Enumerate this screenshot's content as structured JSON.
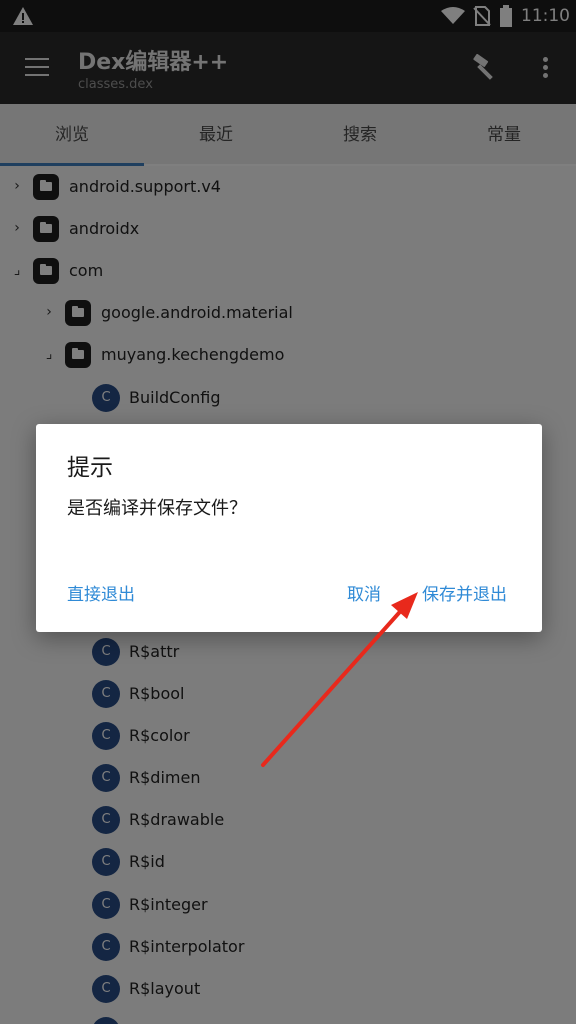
{
  "status_bar": {
    "time": "11:10",
    "icons": [
      "warning-icon",
      "wifi-icon",
      "no-sim-icon",
      "battery-icon"
    ]
  },
  "app_bar": {
    "title": "Dex编辑器++",
    "subtitle": "classes.dex",
    "icons": [
      "menu-icon",
      "hammer-icon",
      "more-vert-icon"
    ]
  },
  "tabs": [
    {
      "label": "浏览",
      "selected": true
    },
    {
      "label": "最近",
      "selected": false
    },
    {
      "label": "搜索",
      "selected": false
    },
    {
      "label": "常量",
      "selected": false
    }
  ],
  "tree": {
    "rows": [
      {
        "type": "folder",
        "label": "android.support.v4",
        "expanded": false,
        "depth": 0
      },
      {
        "type": "folder",
        "label": "androidx",
        "expanded": false,
        "depth": 0
      },
      {
        "type": "folder",
        "label": "com",
        "expanded": true,
        "depth": 0
      },
      {
        "type": "folder",
        "label": "google.android.material",
        "expanded": false,
        "depth": 1
      },
      {
        "type": "folder",
        "label": "muyang.kechengdemo",
        "expanded": true,
        "depth": 1
      },
      {
        "type": "class",
        "label": "BuildConfig",
        "depth": 2
      },
      {
        "type": "class",
        "label": "R$attr",
        "depth": 2
      },
      {
        "type": "class",
        "label": "R$bool",
        "depth": 2
      },
      {
        "type": "class",
        "label": "R$color",
        "depth": 2
      },
      {
        "type": "class",
        "label": "R$dimen",
        "depth": 2
      },
      {
        "type": "class",
        "label": "R$drawable",
        "depth": 2
      },
      {
        "type": "class",
        "label": "R$id",
        "depth": 2
      },
      {
        "type": "class",
        "label": "R$integer",
        "depth": 2
      },
      {
        "type": "class",
        "label": "R$interpolator",
        "depth": 2
      },
      {
        "type": "class",
        "label": "R$layout",
        "depth": 2
      }
    ],
    "class_icon_letter": "C"
  },
  "dialog": {
    "title": "提示",
    "message": "是否编译并保存文件？",
    "button_exit": "直接退出",
    "button_cancel": "取消",
    "button_save_exit": "保存并退出"
  },
  "colors": {
    "accent": "#2f8ad6",
    "tab_indicator": "#3f7fbf",
    "class_icon": "#284c86",
    "annotation_arrow": "#e8291c"
  }
}
